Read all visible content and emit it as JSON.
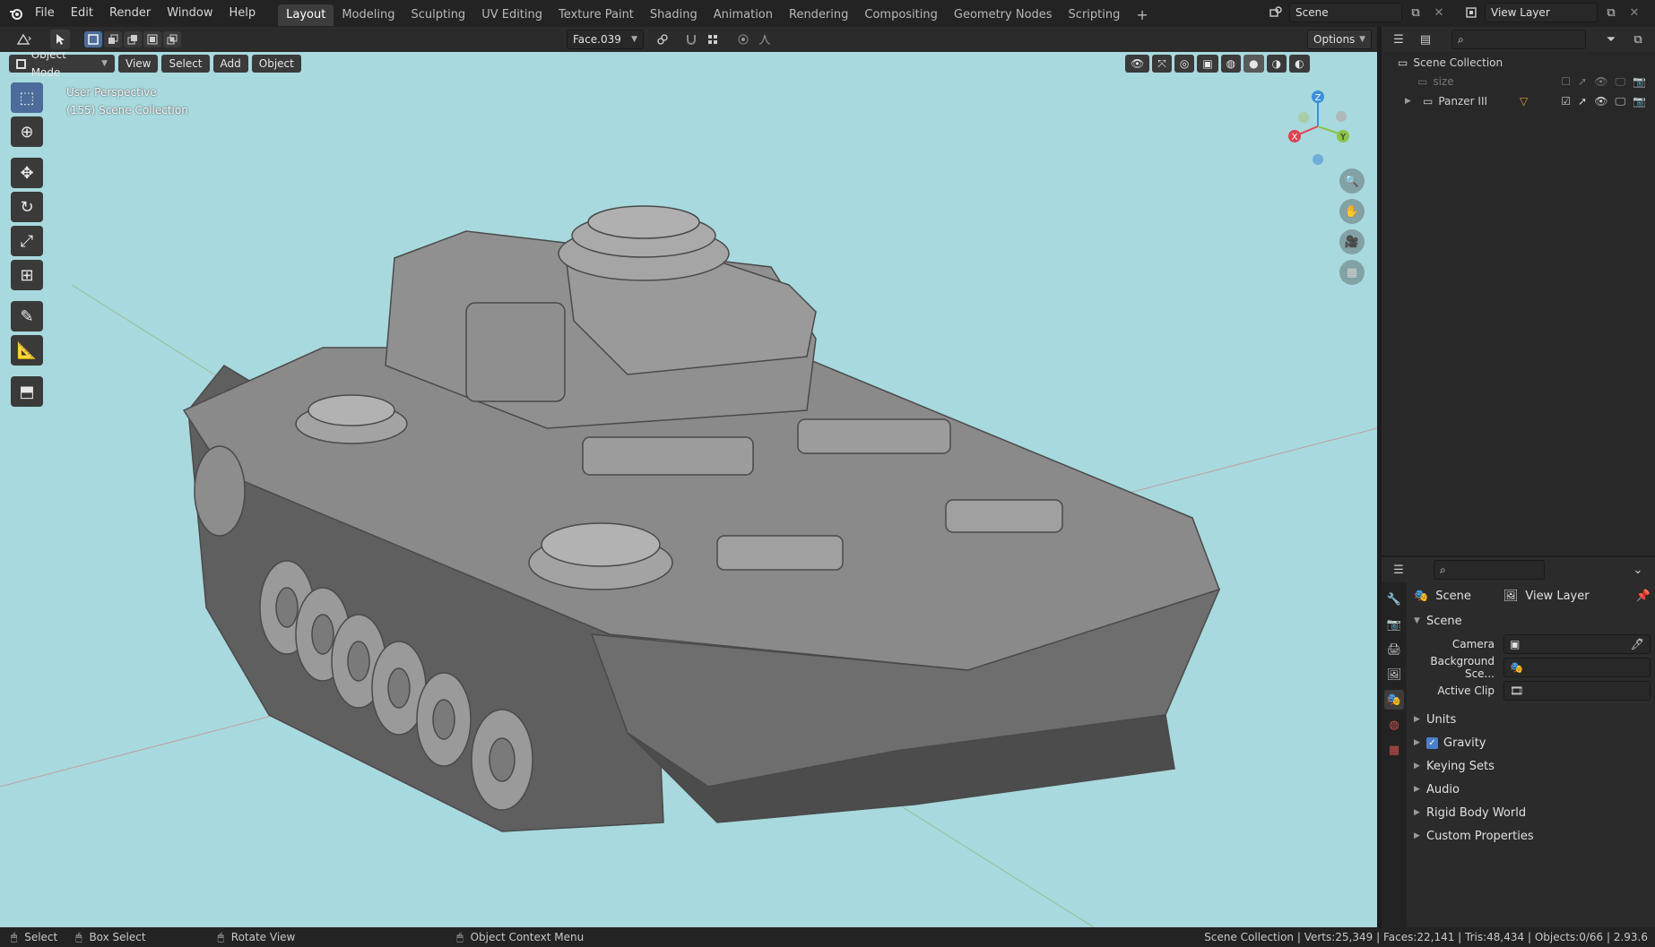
{
  "app": {
    "logo": "blender-logo"
  },
  "menu": [
    "File",
    "Edit",
    "Render",
    "Window",
    "Help"
  ],
  "workspaces": [
    "Layout",
    "Modeling",
    "Sculpting",
    "UV Editing",
    "Texture Paint",
    "Shading",
    "Animation",
    "Rendering",
    "Compositing",
    "Geometry Nodes",
    "Scripting"
  ],
  "workspace_add": "+",
  "scene_selector": {
    "label": "Scene"
  },
  "view_layer_selector": {
    "label": "View Layer"
  },
  "tool_header": {
    "active_element": "Face.039",
    "options_label": "Options"
  },
  "viewport_header": {
    "mode": "Object Mode",
    "menus": [
      "View",
      "Select",
      "Add",
      "Object"
    ]
  },
  "viewport": {
    "perspective": "User Perspective",
    "collection_info": "(155) Scene Collection",
    "gizmo": {
      "x": "X",
      "y": "Y",
      "z": "Z"
    }
  },
  "outliner": {
    "root": "Scene Collection",
    "items": [
      {
        "name": "size",
        "dim": true
      },
      {
        "name": "Panzer III",
        "dim": false
      }
    ]
  },
  "properties": {
    "breadcrumb_scene": "Scene",
    "breadcrumb_layer": "View Layer",
    "panel_title": "Scene",
    "camera_label": "Camera",
    "background_label": "Background Sce...",
    "active_clip_label": "Active Clip",
    "sections": [
      "Units",
      "Gravity",
      "Keying Sets",
      "Audio",
      "Rigid Body World",
      "Custom Properties"
    ]
  },
  "statusbar": {
    "select": "Select",
    "box_select": "Box Select",
    "rotate": "Rotate View",
    "context_menu": "Object Context Menu",
    "stats": "Scene Collection | Verts:25,349 | Faces:22,141 | Tris:48,434 | Objects:0/66 | 2.93.6"
  },
  "colors": {
    "viewport_bg": "#a8d9de",
    "active_tool": "#4c6d9b",
    "axis_x": "#e0424f",
    "axis_y": "#8bc34a",
    "axis_z": "#3b8fe0"
  }
}
